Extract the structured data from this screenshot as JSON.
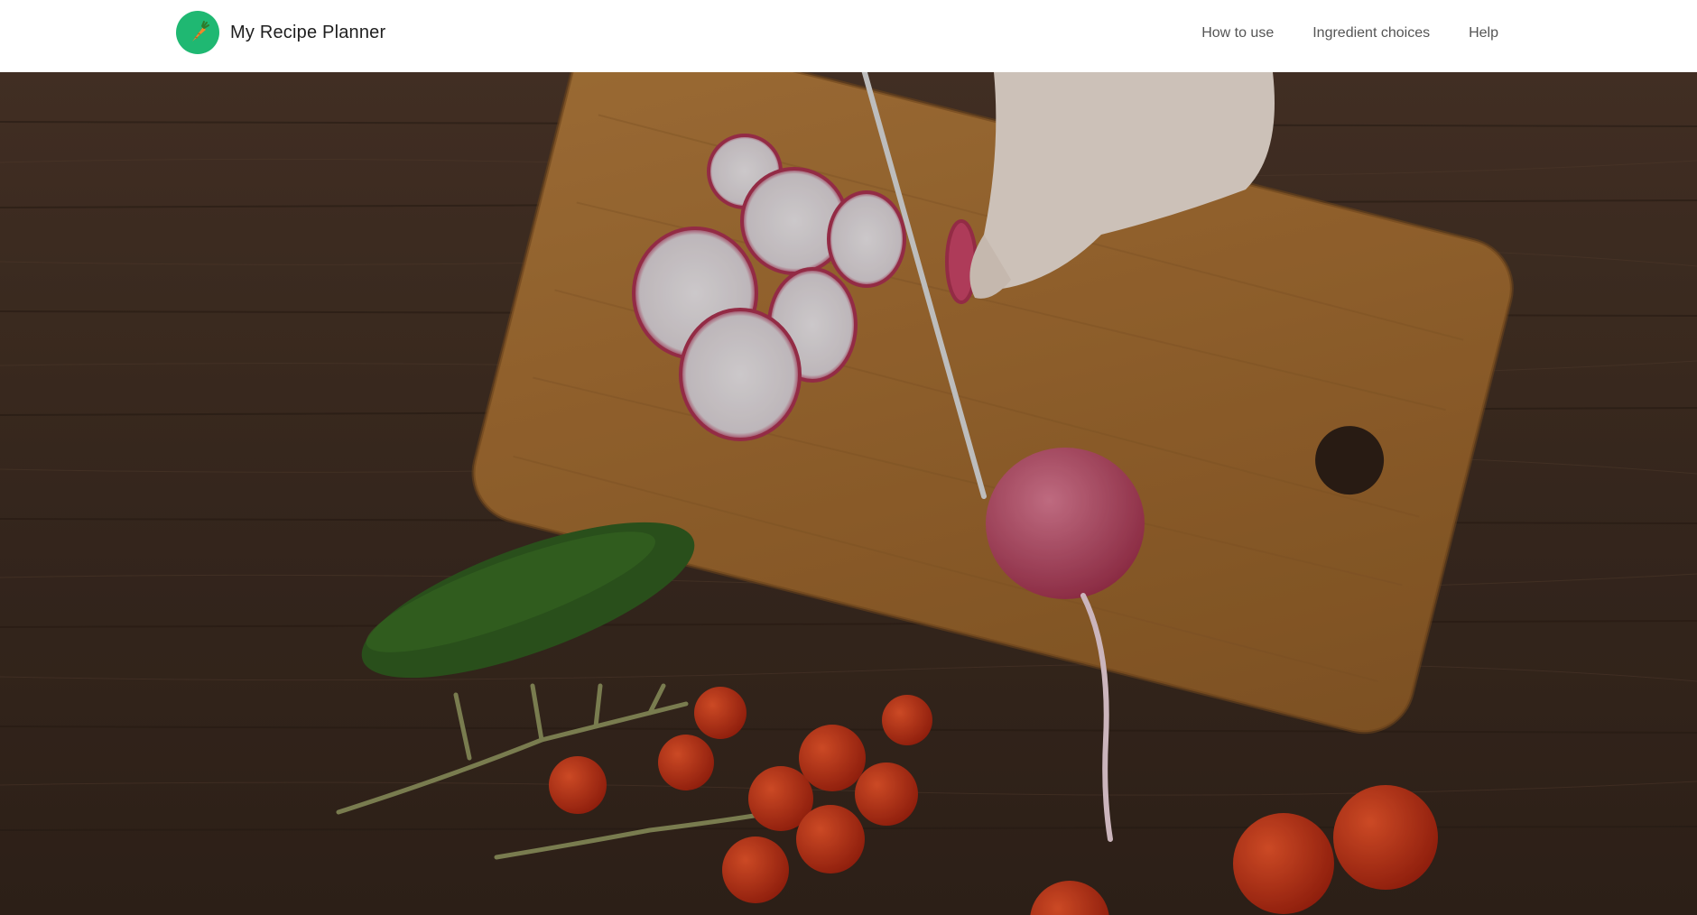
{
  "app": {
    "title": "My Recipe Planner",
    "logo_icon": "carrot-icon",
    "brand_color": "#1fb872"
  },
  "nav": {
    "items": [
      {
        "label": "How to use"
      },
      {
        "label": "Ingredient choices"
      },
      {
        "label": "Help"
      }
    ]
  },
  "hero": {
    "image_subject": "cutting-board-with-vegetables"
  }
}
